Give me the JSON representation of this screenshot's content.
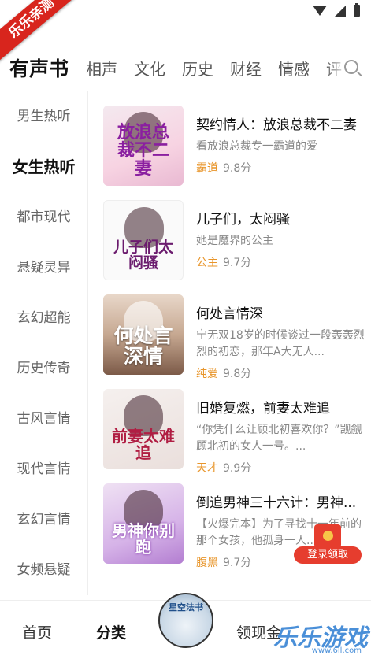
{
  "corner_badge": "乐乐亲测",
  "tabs": [
    "有声书",
    "相声",
    "文化",
    "历史",
    "财经",
    "情感",
    "评"
  ],
  "sidebar": [
    "男生热听",
    "女生热听",
    "都市现代",
    "悬疑灵异",
    "玄幻超能",
    "历史传奇",
    "古风言情",
    "现代言情",
    "玄幻言情",
    "女频悬疑"
  ],
  "books": [
    {
      "title": "契约情人：放浪总裁不二妻",
      "desc": "看放浪总裁专一霸道的爱",
      "tag": "霸道",
      "score": "9.8分",
      "cover_text": "放浪总裁不二妻"
    },
    {
      "title": "儿子们，太闷骚",
      "desc": "她是魔界的公主",
      "tag": "公主",
      "score": "9.7分",
      "cover_text": "儿子们太闷骚"
    },
    {
      "title": "何处言情深",
      "desc": "宁无双18岁的时候谈过一段轰轰烈烈的初恋，那年A大无人...",
      "tag": "纯爱",
      "score": "9.8分",
      "cover_text": "何处言深情"
    },
    {
      "title": "旧婚复燃，前妻太难追",
      "desc": "“你凭什么让顾北初喜欢你？”觊觎顾北初的女人一号。...",
      "tag": "天才",
      "score": "9.9分",
      "cover_text": "前妻太难追"
    },
    {
      "title": "倒追男神三十六计：男神...",
      "desc": "【火爆完本】为了寻找十一年前的那个女孩，他孤身一人...",
      "tag": "腹黑",
      "score": "9.7分",
      "cover_text": "男神你别跑"
    }
  ],
  "red_packet": "登录领取",
  "bottom_nav": {
    "home": "首页",
    "category": "分类",
    "center": "星空法书",
    "cash": "领现金",
    "watermark": "乐乐游戏",
    "watermark_sub": "www.6ll.com"
  },
  "colors": {
    "accent": "#e8952a",
    "red": "#e63d2e",
    "corner": "#d8251d"
  }
}
